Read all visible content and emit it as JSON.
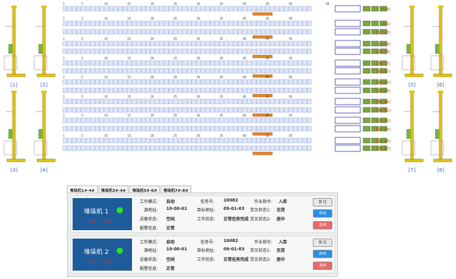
{
  "cranes": [
    {
      "label": "[1]"
    },
    {
      "label": "[2]"
    },
    {
      "label": "[3]"
    },
    {
      "label": "[4]"
    },
    {
      "label": "[5]"
    },
    {
      "label": "[6]"
    },
    {
      "label": "[7]"
    },
    {
      "label": "[8]"
    }
  ],
  "rack_rows": [
    {
      "ticks": [
        "1",
        "5",
        "10",
        "15",
        "20",
        "25",
        "30",
        "35",
        "40",
        "45",
        "50",
        "58"
      ],
      "code": "[5-8]"
    },
    {
      "ticks": [
        "1",
        "5",
        "10",
        "15",
        "20",
        "25",
        "30",
        "35",
        "40",
        "45",
        "50"
      ],
      "code": "[4-1]"
    },
    {
      "ticks": [
        "1",
        "5",
        "10",
        "15",
        "20",
        "25",
        "30",
        "35",
        "40",
        "45",
        "50"
      ],
      "code": "[13-16]"
    },
    {
      "ticks": [
        "1",
        "5",
        "10",
        "15",
        "20",
        "25",
        "30",
        "35",
        "40",
        "45",
        "50"
      ],
      "code": "[12-9]"
    },
    {
      "ticks": [
        "1",
        "5",
        "10",
        "15",
        "20",
        "25",
        "30",
        "35",
        "40",
        "45",
        "50"
      ],
      "code": "[21-24]"
    },
    {
      "ticks": [
        "1",
        "5",
        "10",
        "15",
        "20",
        "25",
        "30",
        "35",
        "40",
        "45",
        "50"
      ],
      "code": "[20-17]"
    },
    {
      "ticks": [
        "1",
        "5",
        "10",
        "15",
        "20",
        "25",
        "30",
        "35",
        "40",
        "45",
        "50"
      ],
      "code": "[29-32]"
    },
    {
      "ticks": [
        "1",
        "5",
        "10",
        "15",
        "20",
        "25",
        "30",
        "35",
        "40",
        "45",
        "50"
      ],
      "code": "[28-25]"
    },
    {
      "ticks": [
        "1",
        "5",
        "10",
        "15",
        "20",
        "25",
        "30",
        "35",
        "40",
        "45",
        "50"
      ],
      "code": "[36-33]"
    },
    {
      "ticks": [
        "1",
        "5",
        "10",
        "15",
        "20",
        "25",
        "30",
        "35",
        "40",
        "45",
        "50"
      ],
      "code": "[45-48]"
    },
    {
      "ticks": [
        "1",
        "5",
        "10",
        "15",
        "20",
        "25",
        "30",
        "35",
        "40",
        "45",
        "50"
      ],
      "code": "[44-41]"
    },
    {
      "ticks": [
        "1",
        "5",
        "10",
        "15",
        "20",
        "25",
        "30",
        "35",
        "40",
        "45",
        "50"
      ],
      "code": "[53-56]"
    },
    {
      "ticks": [
        "1",
        "5",
        "10",
        "15",
        "20",
        "25",
        "30",
        "35",
        "40",
        "45",
        "50"
      ],
      "code": "[52-49]"
    },
    {
      "ticks": [
        "1",
        "5",
        "10",
        "15",
        "20",
        "25",
        "30",
        "35",
        "40",
        "45",
        "50"
      ],
      "code": "[61-64]"
    },
    {
      "ticks": [
        "1",
        "5",
        "10",
        "15",
        "20",
        "25",
        "30",
        "35",
        "40",
        "45",
        "50",
        "54",
        "58"
      ],
      "code": "[60-57]"
    }
  ],
  "tabs": [
    "堆垛机1#-4#",
    "堆垛机3#-4#",
    "堆垛机5#-6#",
    "堆垛机7#-8#"
  ],
  "machines": [
    {
      "name": "堆垛机 1",
      "position": "10 - 00",
      "work_mode_label": "工作模式:",
      "work_mode": "自动",
      "task_no_label": "任务号:",
      "task_no": "10082",
      "command_label": "作业指令:",
      "command": "入库",
      "source_label": "源地址:",
      "source": "10-00-01",
      "target_label": "目标地址:",
      "target": "09-01-03",
      "fork1_label": "货叉状态1:",
      "fork1": "无货",
      "device_label": "设备状态:",
      "device": "空闲",
      "work_status_label": "工作状态:",
      "work_status": "正常任务完成",
      "fork2_label": "货叉状态2:",
      "fork2": "居中",
      "alarm_label": "报警信息:",
      "alarm": "正常",
      "btn_reset": "复 位",
      "btn_start": "启动",
      "btn_stop": "急停"
    },
    {
      "name": "堆垛机 2",
      "position": "10 - 00",
      "work_mode_label": "工作模式:",
      "work_mode": "自动",
      "task_no_label": "任务号:",
      "task_no": "10082",
      "command_label": "作业指令:",
      "command": "入库",
      "source_label": "源地址:",
      "source": "10-00-01",
      "target_label": "目标地址:",
      "target": "09-01-03",
      "fork1_label": "货叉状态1:",
      "fork1": "无货",
      "device_label": "设备状态:",
      "device": "空闲",
      "work_status_label": "工作状态:",
      "work_status": "正常任务完成",
      "fork2_label": "货叉状态2:",
      "fork2": "居中",
      "alarm_label": "报警信息:",
      "alarm": "正常",
      "btn_reset": "复 位",
      "btn_start": "启动",
      "btn_stop": "急停"
    }
  ],
  "colors": {
    "rack_fill": "#dfe6f7",
    "rack_stroke": "#8ea3d6",
    "code": "#d43020",
    "label": "#2d5fc4",
    "shuttle": "#e6872b",
    "crane": "#e3c416",
    "badge": "#1e5b9a",
    "conveyor": "#3d3aa6",
    "pallet": "#7aa83a"
  }
}
